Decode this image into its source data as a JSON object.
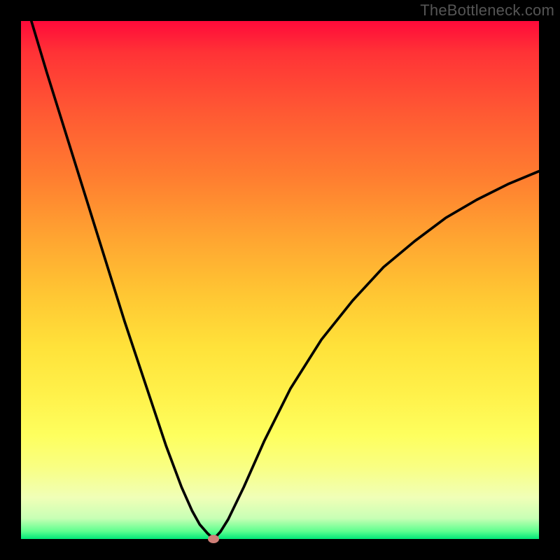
{
  "watermark": "TheBottleneck.com",
  "chart_data": {
    "type": "line",
    "title": "",
    "xlabel": "",
    "ylabel": "",
    "xlim": [
      0,
      100
    ],
    "ylim": [
      0,
      100
    ],
    "grid": false,
    "colormap": "red-yellow-green (bottleneck heatmap)",
    "marker": {
      "x": 37.2,
      "y": 0,
      "color": "#cf7f77"
    },
    "series": [
      {
        "name": "bottleneck-curve",
        "x": [
          2,
          5,
          10,
          15,
          20,
          25,
          28,
          31,
          33,
          34.5,
          36,
          37.2,
          38.5,
          40,
          43,
          47,
          52,
          58,
          64,
          70,
          76,
          82,
          88,
          94,
          100
        ],
        "y": [
          100,
          90,
          74,
          58,
          42,
          27,
          18,
          10,
          5.5,
          2.8,
          1.1,
          0,
          1.4,
          3.8,
          10,
          19,
          29,
          38.5,
          46,
          52.5,
          57.5,
          62,
          65.5,
          68.5,
          71
        ]
      }
    ]
  },
  "icons": {
    "marker": "marker-dot"
  }
}
